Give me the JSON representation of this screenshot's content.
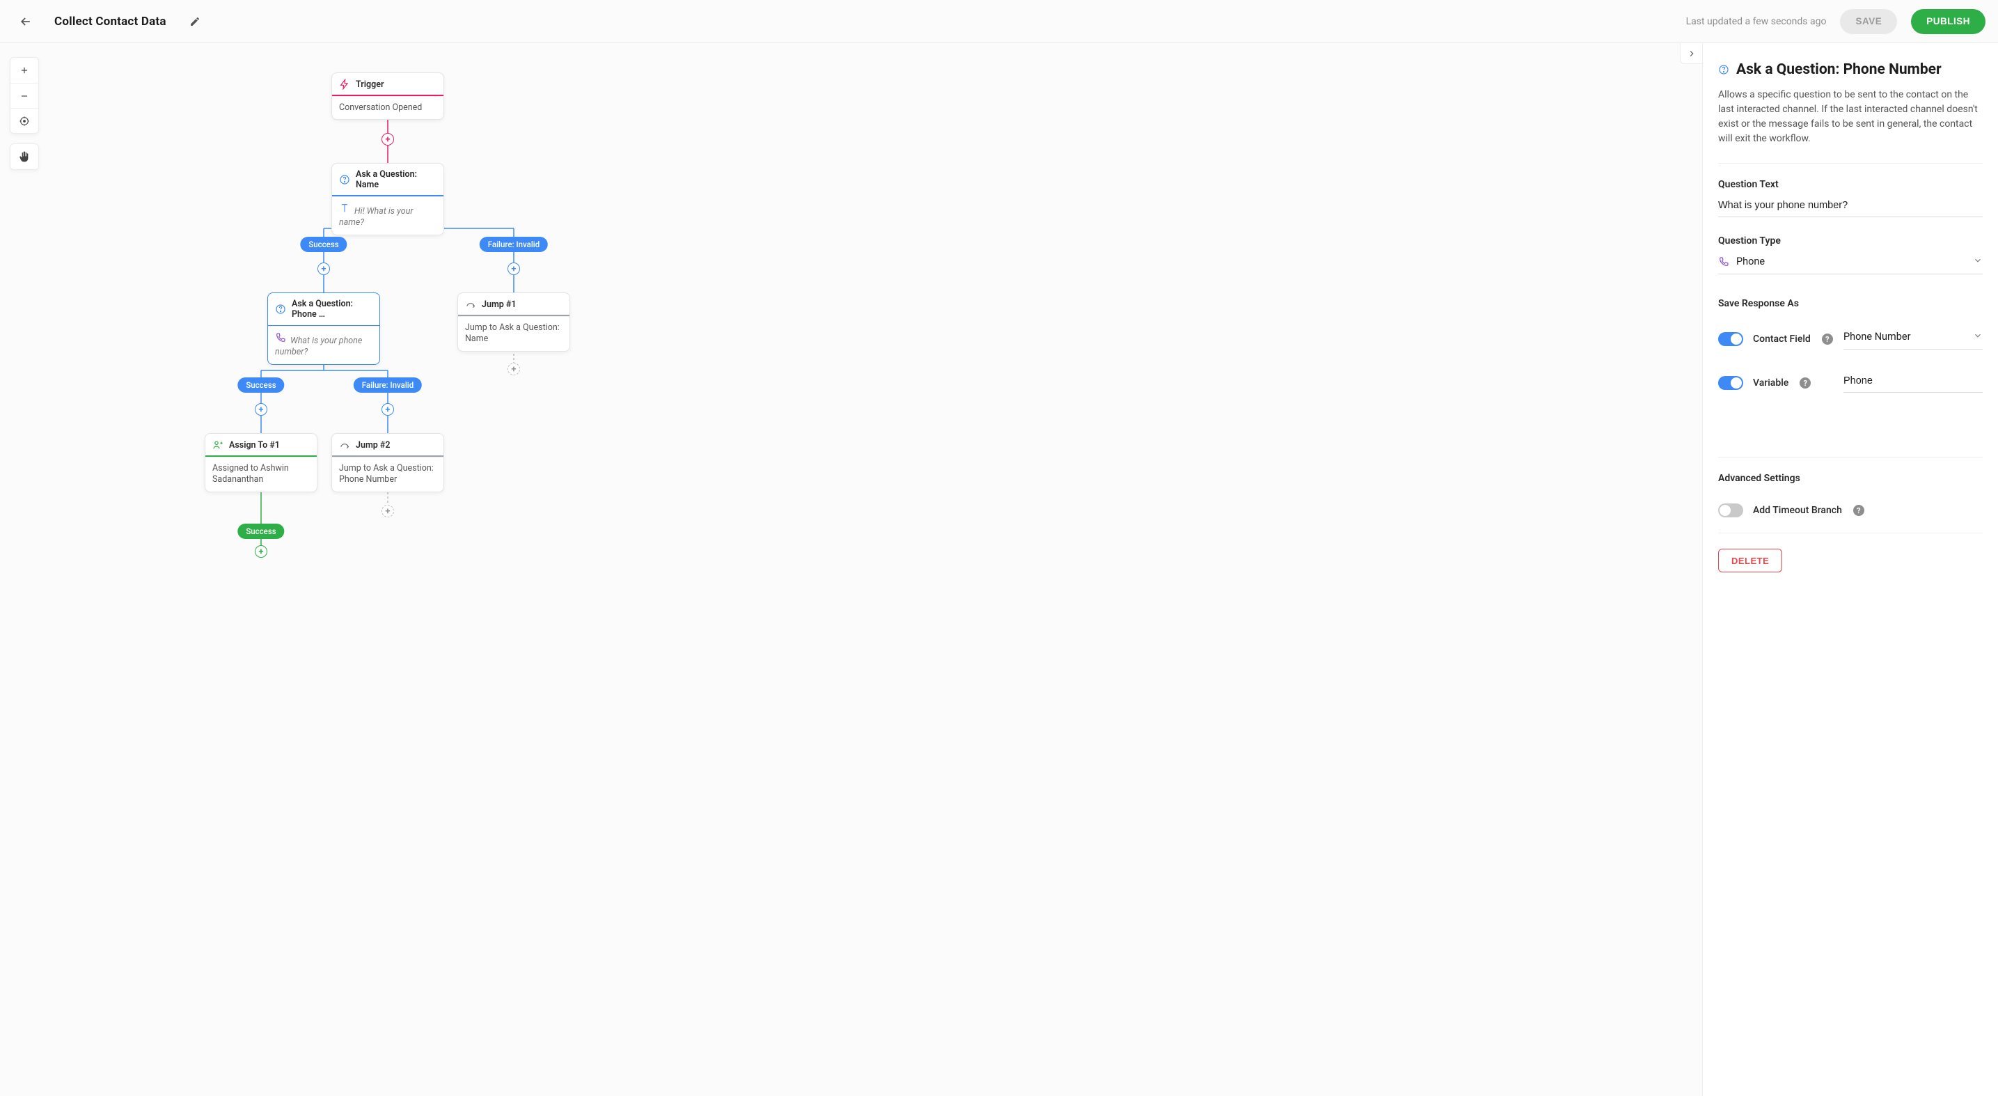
{
  "header": {
    "title": "Collect Contact Data",
    "status": "Last updated a few seconds ago",
    "save_label": "SAVE",
    "publish_label": "PUBLISH"
  },
  "flow": {
    "trigger": {
      "title": "Trigger",
      "body": "Conversation Opened"
    },
    "ask_name": {
      "title": "Ask a Question: Name",
      "body": "Hi! What is your name?"
    },
    "ask_phone": {
      "title": "Ask a Question: Phone …",
      "body": "What is your phone number?"
    },
    "jump1": {
      "title": "Jump #1",
      "body": "Jump to Ask a Question: Name"
    },
    "jump2": {
      "title": "Jump #2",
      "body": "Jump to Ask a Question: Phone Number"
    },
    "assign": {
      "title": "Assign To #1",
      "body": "Assigned to Ashwin Sadananthan"
    },
    "pills": {
      "name_success": "Success",
      "name_fail": "Failure: Invalid",
      "phone_success": "Success",
      "phone_fail": "Failure: Invalid",
      "assign_success": "Success"
    }
  },
  "panel": {
    "title": "Ask a Question: Phone Number",
    "description": "Allows a specific question to be sent to the contact on the last interacted channel. If the last interacted channel doesn't exist or the message fails to be sent in general, the contact will exit the workflow.",
    "q_text_label": "Question Text",
    "q_text_value": "What is your phone number?",
    "q_type_label": "Question Type",
    "q_type_value": "Phone",
    "save_as_label": "Save Response As",
    "contact_field_label": "Contact Field",
    "contact_field_value": "Phone Number",
    "variable_label": "Variable",
    "variable_value": "Phone",
    "adv_label": "Advanced Settings",
    "timeout_label": "Add Timeout Branch",
    "delete_label": "DELETE"
  },
  "colors": {
    "blue": "#3d8af7",
    "green": "#2eae46",
    "pink": "#e91e63",
    "grey": "#9da3a8",
    "purple": "#8a4fd6"
  }
}
